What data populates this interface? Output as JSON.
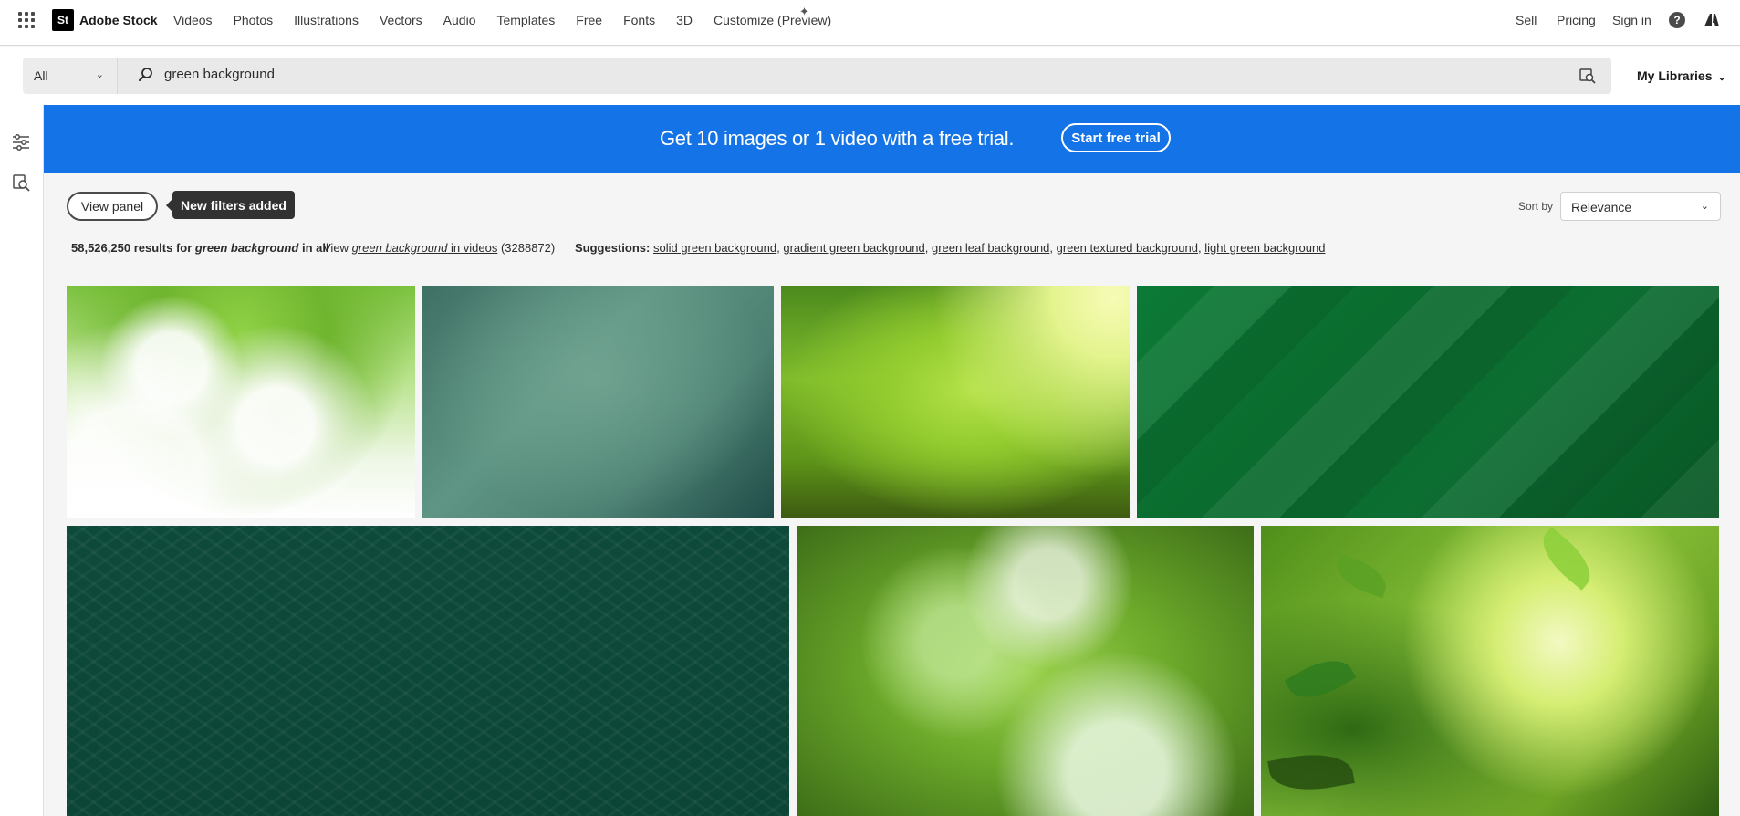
{
  "nav": {
    "logo_badge": "St",
    "logo_text": "Adobe Stock",
    "links": [
      "Videos",
      "Photos",
      "Illustrations",
      "Vectors",
      "Audio",
      "Templates",
      "Free",
      "Fonts",
      "3D",
      "Customize (Preview)"
    ],
    "right": {
      "sell": "Sell",
      "pricing": "Pricing",
      "sign_in": "Sign in",
      "help": "?"
    }
  },
  "search": {
    "asset_type": "All",
    "query": "green background",
    "libraries": "My Libraries"
  },
  "promo": {
    "text": "Get 10 images or 1 video with a free trial.",
    "button": "Start free trial",
    "background": "#1473e6"
  },
  "filters": {
    "view_panel": "View panel",
    "tooltip": "New filters added",
    "sort_label": "Sort by",
    "sort_value": "Relevance"
  },
  "results": {
    "count": "58,526,250",
    "results_for": "results for",
    "query": "green background",
    "scope": "in all",
    "view_prefix": "View",
    "video_query": "green background",
    "video_suffix": "in videos",
    "video_count": "(3288872)",
    "suggestions_label": "Suggestions:",
    "suggestions": [
      "solid green background",
      "gradient green background",
      "green leaf background",
      "green textured background",
      "light green background"
    ]
  },
  "icons": {
    "apps": "apps-grid-icon",
    "search": "search-icon",
    "visual_search": "visual-search-icon",
    "filters": "filter-sliders-icon",
    "search_similar": "find-similar-icon",
    "help": "help-icon",
    "adobe": "adobe-logo-icon",
    "sparkle": "sparkle-icon"
  }
}
